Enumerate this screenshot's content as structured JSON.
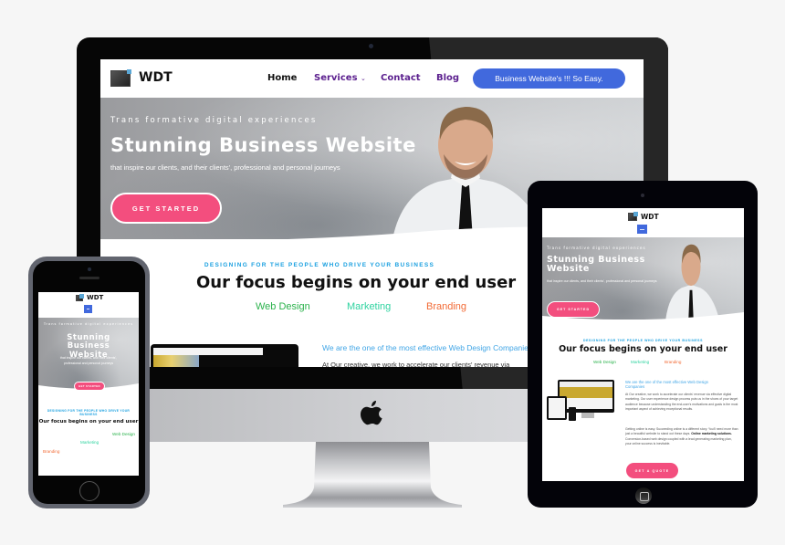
{
  "brand": {
    "name": "WDT",
    "logo_icon": "wdt-logo-icon"
  },
  "desktop": {
    "nav": {
      "items": [
        {
          "label": "Home",
          "color": "#111111"
        },
        {
          "label": "Services",
          "color": "#5b1f8e",
          "has_dropdown": true,
          "dropdown_icon": "⌄"
        },
        {
          "label": "Contact",
          "color": "#5b1f8e"
        },
        {
          "label": "Blog",
          "color": "#5b1f8e"
        }
      ],
      "cta_label": "Business Website's !!! So Easy.",
      "cta_color": "#4169dd"
    },
    "hero": {
      "kicker": "Trans formative digital experiences",
      "title": "Stunning Business Website",
      "subtitle": "that inspire our clients, and their clients', professional and personal journeys",
      "button_label": "GET STARTED",
      "button_color": "#f34e7e"
    },
    "section": {
      "kicker": "DESIGNING FOR THE PEOPLE WHO DRIVE YOUR BUSINESS",
      "heading": "Our focus begins on your end user",
      "services": [
        {
          "label": "Web Design",
          "color": "#2bb24c"
        },
        {
          "label": "Marketing",
          "color": "#2fd3a0"
        },
        {
          "label": "Branding",
          "color": "#f26a35"
        }
      ],
      "about_title": "We are the one of the most effective Web Design Companies",
      "about_text": "At Our creative, we work to accelerate our clients' revenue via"
    }
  },
  "tablet": {
    "menu_icon": "hamburger-menu-icon",
    "hero": {
      "kicker": "Trans formative digital experiences",
      "title": "Stunning Business Website",
      "subtitle": "that inspire our clients, and their clients', professional and personal journeys",
      "button_label": "GET STARTED"
    },
    "section": {
      "kicker": "DESIGNING FOR THE PEOPLE WHO DRIVE YOUR BUSINESS",
      "heading": "Our focus begins on your end user",
      "services": [
        "Web Design",
        "Marketing",
        "Branding"
      ],
      "about_title": "We are the one of the most effective Web Design Companies",
      "paragraph1": "At Our creative, we work to accelerate our clients' revenue via effective digital marketing. Our user experience design process puts us in the shoes of your target audience because understanding the end-user's motivations and goals is the most important aspect of achieving exceptional results.",
      "paragraph2_start": "Getting online is easy. Succeeding online is a different story. You'll need more than just a beautiful website to stand out these days.",
      "paragraph2_bold": "Online marketing solutions.",
      "paragraph2_end": "Conversion-based web design coupled with a lead generating marketing plan, your online success is inevitable.",
      "quote_button": "GET A QUOTE"
    }
  },
  "phone": {
    "hero": {
      "kicker": "Trans formative digital experiences",
      "title": "Stunning Business Website",
      "subtitle": "that inspire our clients, and their clients', professional and personal journeys",
      "button_label": "GET STARTED"
    },
    "section": {
      "kicker": "DESIGNING FOR THE PEOPLE WHO DRIVE YOUR BUSINESS",
      "heading": "Our focus begins on your end user",
      "services": [
        "Web Design",
        "Marketing",
        "Branding"
      ]
    }
  }
}
